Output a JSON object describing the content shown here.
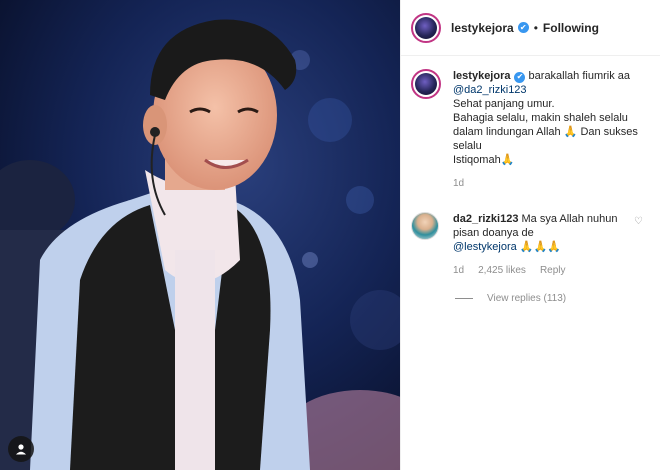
{
  "post": {
    "author": "lestykejora",
    "separator": "•",
    "follow_status": "Following",
    "verified_glyph": "✔"
  },
  "caption": {
    "username": "lestykejora",
    "line1": " barakallah fiumrik aa",
    "mention": "@da2_rizki123",
    "line2": "Sehat panjang umur.",
    "line3": "Bahagia selalu, makin shaleh selalu dalam lindungan Allah 🙏 Dan sukses selalu",
    "line4": "Istiqomah🙏",
    "time": "1d"
  },
  "comment": {
    "username": "da2_rizki123",
    "text1": " Ma sya Allah nuhun pisan doanya de",
    "mention": "@lestykejora",
    "text2": " 🙏🙏🙏",
    "time": "1d",
    "likes": "2,425 likes",
    "reply": "Reply",
    "heart": "♡"
  },
  "view_replies": "View replies (113)",
  "icons": {
    "verified": "verified-badge-icon",
    "heart": "heart-icon",
    "user_tag": "user-tag-icon"
  },
  "colors": {
    "verified": "#3897f0",
    "mention": "#00376b",
    "meta": "#8e8e8e",
    "story_ring": "#c13584"
  }
}
